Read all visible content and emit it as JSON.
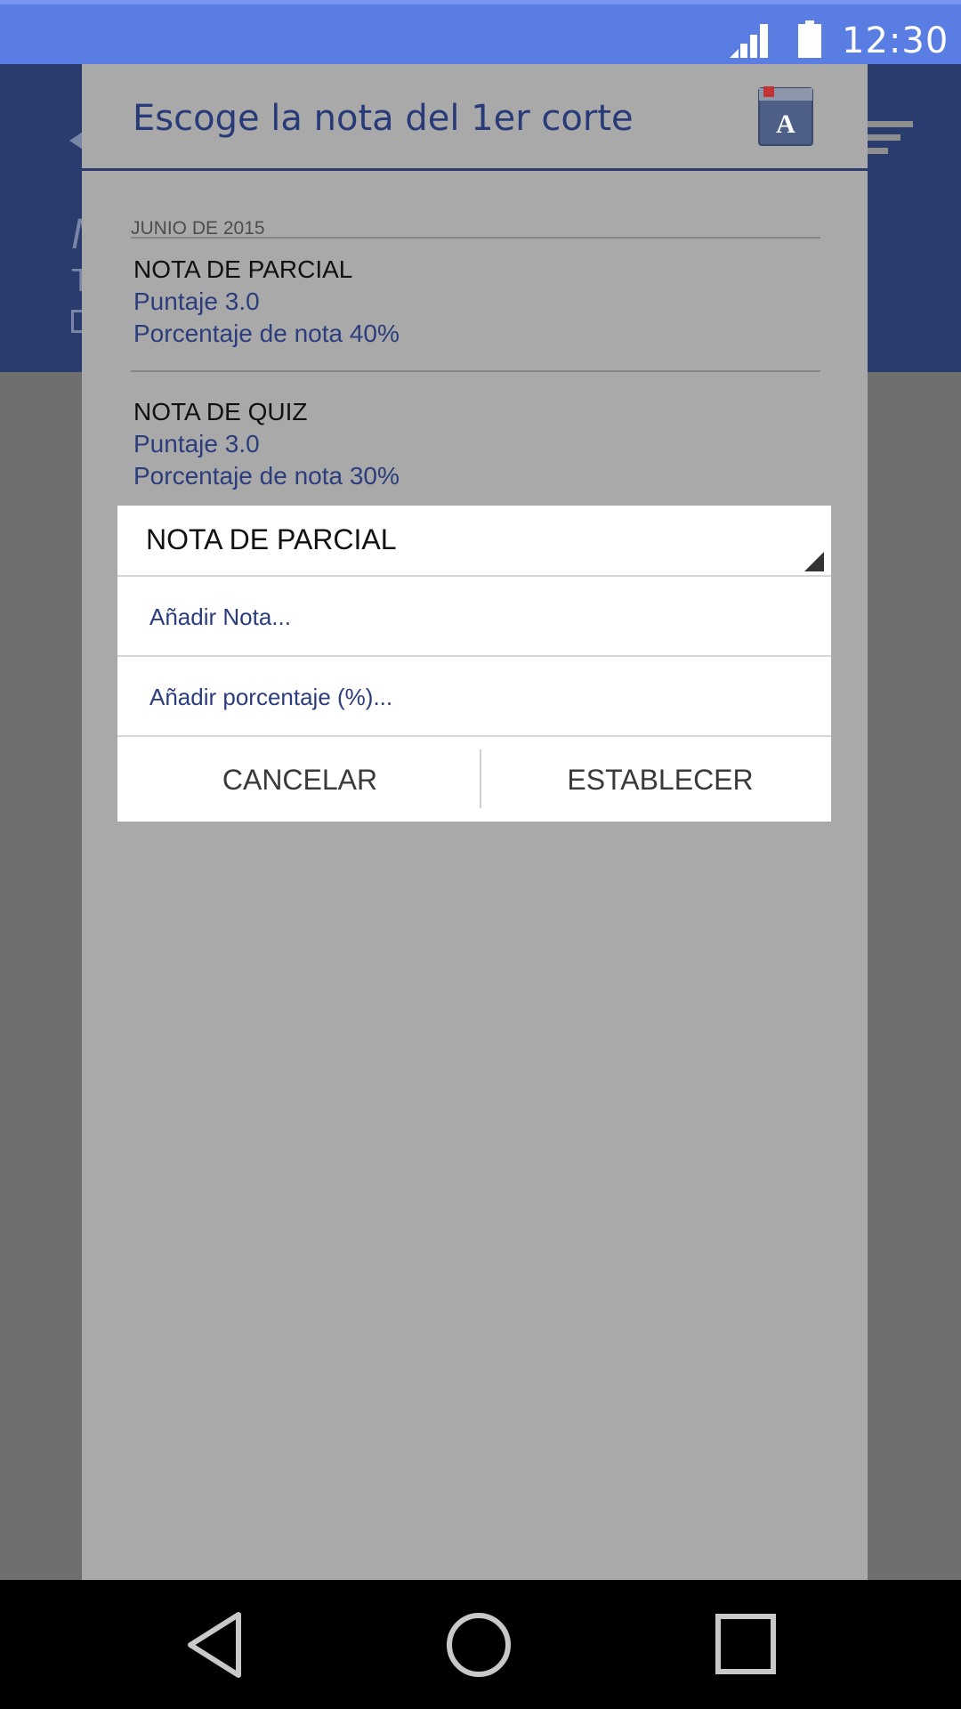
{
  "status_bar": {
    "time": "12:30",
    "icons": [
      "signal-icon",
      "battery-icon"
    ],
    "color": "#5a7de3"
  },
  "background_app": {
    "header_color": "#2a3b6e",
    "icons": [
      "back-arrow-icon",
      "sort-menu-icon"
    ]
  },
  "dialog": {
    "title": "Escoge la nota del 1er corte",
    "title_icon": "notebook-icon",
    "section_label": "JUNIO DE 2015",
    "entries": [
      {
        "title": "NOTA DE PARCIAL",
        "score": "Puntaje 3.0",
        "percent": "Porcentaje de nota 40%"
      },
      {
        "title": "NOTA DE QUIZ",
        "score": "Puntaje 3.0",
        "percent": "Porcentaje de nota 30%"
      }
    ]
  },
  "subdialog": {
    "selected_type": "NOTA DE PARCIAL",
    "note_placeholder": "Añadir Nota...",
    "percent_placeholder": "Añadir porcentaje (%)...",
    "cancel_label": "CANCELAR",
    "confirm_label": "ESTABLECER"
  },
  "nav_bar": {
    "icons": [
      "back-nav-icon",
      "home-nav-icon",
      "recents-nav-icon"
    ]
  }
}
